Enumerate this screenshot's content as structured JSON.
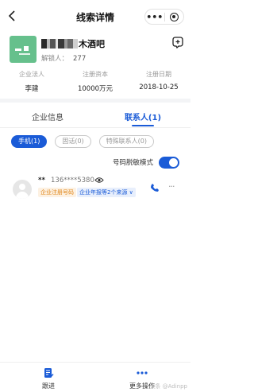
{
  "header": {
    "title": "线索详情",
    "more_glyph": "•••",
    "target_icon": "target-icon"
  },
  "company": {
    "name_suffix": "木酒吧",
    "lock_label": "解锁人：",
    "lock_count": "277",
    "logo_color": "#66c08c"
  },
  "info": [
    {
      "label": "企业法人",
      "value": "李建"
    },
    {
      "label": "注册资本",
      "value": "10000万元"
    },
    {
      "label": "注册日期",
      "value": "2018-10-25"
    }
  ],
  "tabs": [
    {
      "label": "企业信息",
      "active": false
    },
    {
      "label": "联系人(1)",
      "active": true
    }
  ],
  "filters": [
    {
      "label": "手机(1)",
      "active": true
    },
    {
      "label": "固话(0)",
      "active": false
    },
    {
      "label": "特殊联系人(0)",
      "active": false
    }
  ],
  "desensitize": {
    "label": "号码脱敏模式",
    "on": true
  },
  "contact": {
    "name": "**",
    "phone": "136****5380",
    "tag_source": "企业注册号码",
    "tag_reports": "企业年报等2个来源 ∨"
  },
  "bottom": {
    "follow_label": "跟进",
    "more_label": "更多操作"
  },
  "watermark": "头条 @Adinpp",
  "colors": {
    "accent": "#1a5bd7",
    "tag_orange": "#e0861a"
  }
}
